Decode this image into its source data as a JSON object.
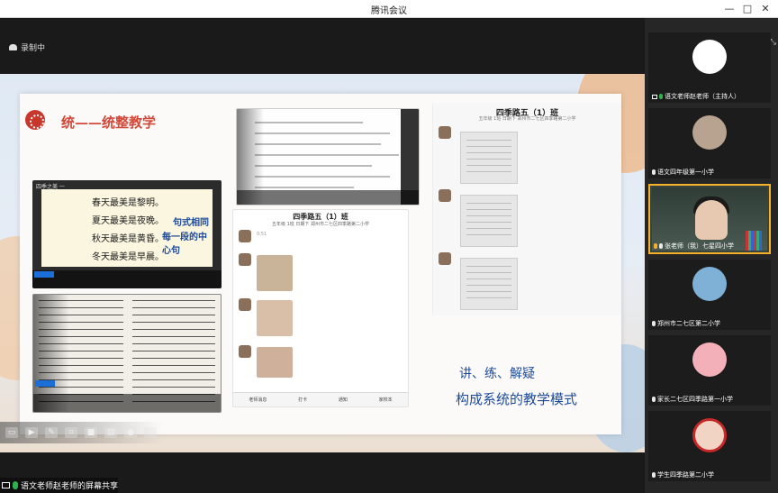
{
  "window": {
    "title": "腾讯会议",
    "controls": [
      "—",
      "□",
      "✕"
    ]
  },
  "recording": {
    "label": "录制中"
  },
  "slide": {
    "title": "统——统整教学",
    "poem": {
      "header": "四季之美 一",
      "lines": [
        "春天最美是黎明。",
        "夏天最美是夜晚。",
        "秋天最美是黄昏。",
        "冬天最美是早晨。"
      ],
      "side_note_1": "句式相同",
      "side_note_2": "每一段的中心句"
    },
    "phone_left": {
      "title": "四季路五（1）班",
      "subtitle": "五年级 1班 日期下 郑州市二七区四季路第二小学",
      "footer": [
        "老师消息",
        "打卡",
        "通知",
        "家校本"
      ],
      "time": "0:51"
    },
    "phone_right": {
      "title": "四季路五（1）班",
      "subtitle": "五年级 1班 日期下 郑州市二七区四季路第二小学"
    },
    "caption_1": "讲、练、解疑",
    "caption_2": "构成系统的教学模式"
  },
  "presenter_label": "语文老师赵老师的屏幕共享",
  "participants": [
    {
      "name": "语文老师赵老师（主持人）",
      "color": "#ffffff"
    },
    {
      "name": "语文四年级第一小学",
      "color": "#b7a38f"
    },
    {
      "name": "张老师（我）七星四小学",
      "color": "#e7c9b2"
    },
    {
      "name": "郑州市二七区第二小学",
      "color": "#7fb0d6"
    },
    {
      "name": "家长二七区四季路第一小学",
      "color": "#f3b0b8"
    },
    {
      "name": "学生四季路第二小学",
      "color": "#f2d4c4"
    }
  ],
  "colors": {
    "accent_red": "#d4483a",
    "accent_blue": "#1d4b9a",
    "active_border": "#f5b229",
    "mic_green": "#2fb24b"
  }
}
